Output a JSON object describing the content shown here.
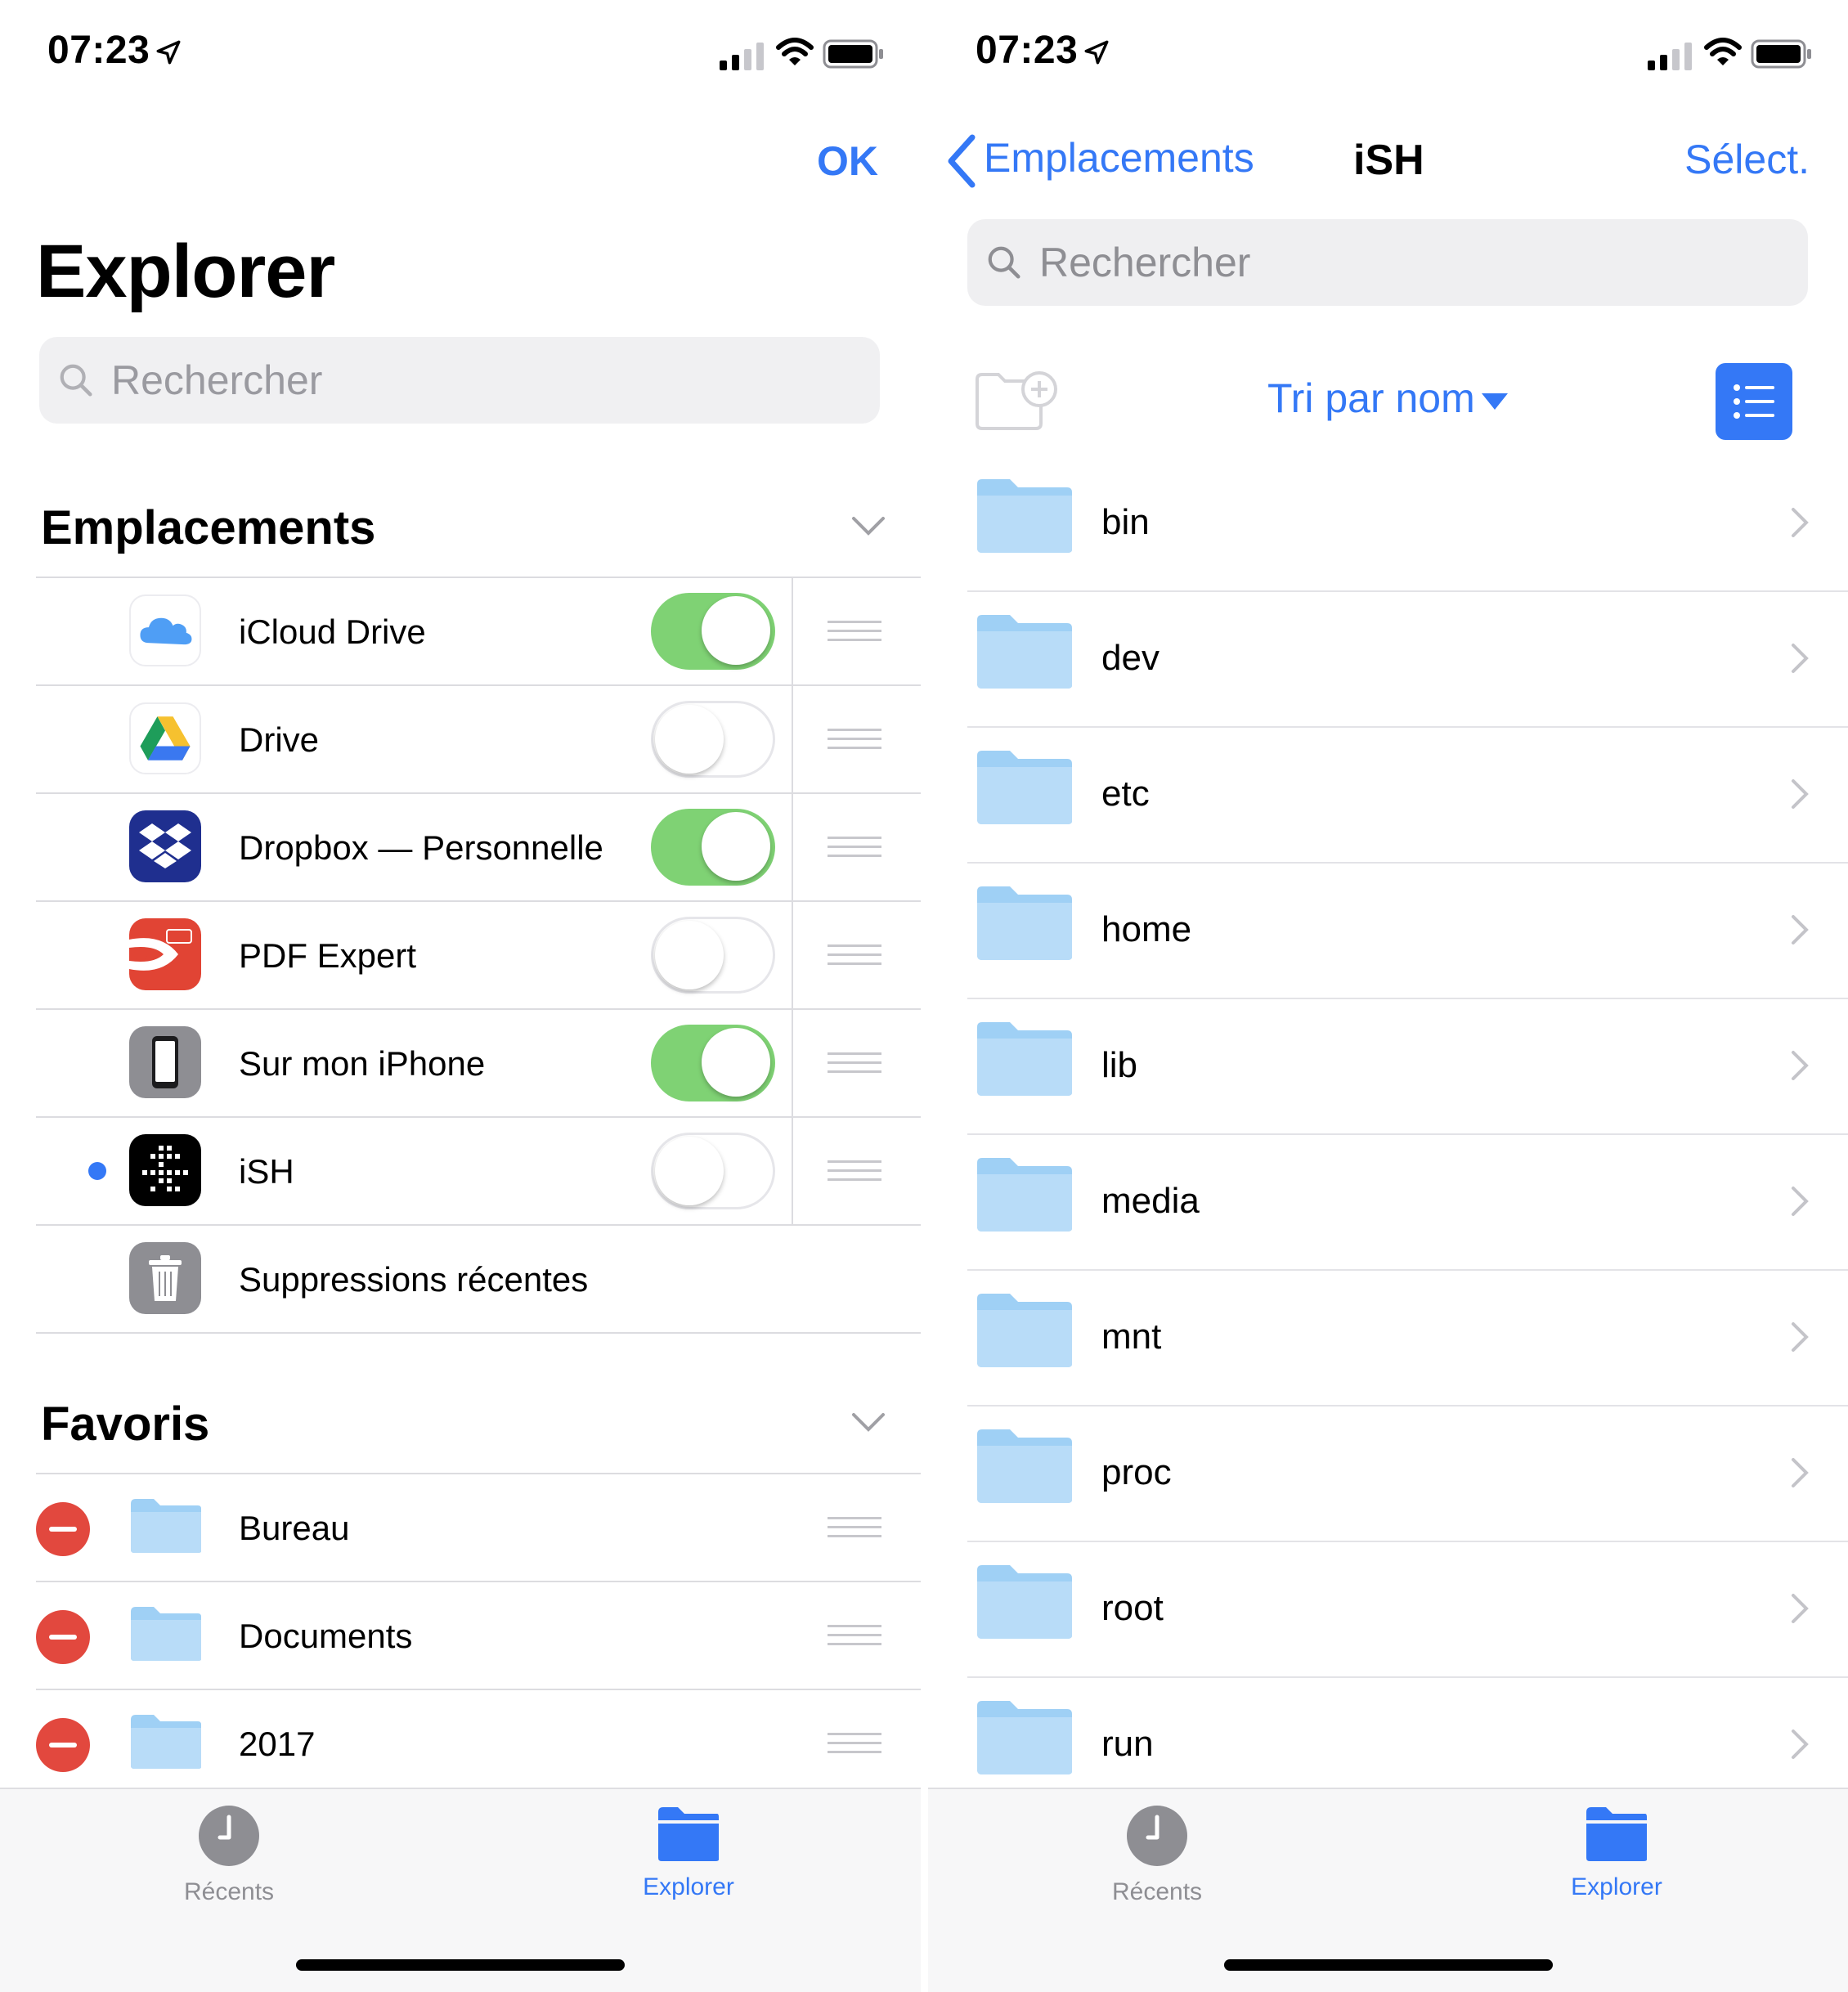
{
  "status": {
    "time": "07:23"
  },
  "colors": {
    "accent": "#3478f6",
    "toggle_on": "#7fd274",
    "delete": "#e2483e",
    "folder": "#9fd0f5"
  },
  "left": {
    "ok_label": "OK",
    "title": "Explorer",
    "search_placeholder": "Rechercher",
    "locations": {
      "header": "Emplacements",
      "items": [
        {
          "label": "iCloud Drive",
          "icon": "icloud-icon",
          "enabled": true
        },
        {
          "label": "Drive",
          "icon": "google-drive-icon",
          "enabled": false
        },
        {
          "label": "Dropbox — Personnelle",
          "icon": "dropbox-icon",
          "enabled": true
        },
        {
          "label": "PDF Expert",
          "icon": "pdf-expert-icon",
          "enabled": false
        },
        {
          "label": "Sur mon iPhone",
          "icon": "iphone-icon",
          "enabled": true
        },
        {
          "label": "iSH",
          "icon": "ish-icon",
          "enabled": false,
          "selected": true
        },
        {
          "label": "Suppressions récentes",
          "icon": "trash-icon"
        }
      ]
    },
    "favorites": {
      "header": "Favoris",
      "items": [
        {
          "label": "Bureau",
          "icon": "folder-icon"
        },
        {
          "label": "Documents",
          "icon": "folder-icon"
        },
        {
          "label": "2017",
          "icon": "folder-icon"
        }
      ]
    },
    "tabs": [
      {
        "label": "Récents",
        "icon": "clock-icon",
        "active": false
      },
      {
        "label": "Explorer",
        "icon": "folder-icon",
        "active": true
      }
    ]
  },
  "right": {
    "back_label": "Emplacements",
    "title": "iSH",
    "select_label": "Sélect.",
    "search_placeholder": "Rechercher",
    "sort_label": "Tri par nom",
    "folders": [
      "bin",
      "dev",
      "etc",
      "home",
      "lib",
      "media",
      "mnt",
      "proc",
      "root",
      "run"
    ],
    "tabs": [
      {
        "label": "Récents",
        "icon": "clock-icon",
        "active": false
      },
      {
        "label": "Explorer",
        "icon": "folder-icon",
        "active": true
      }
    ]
  }
}
